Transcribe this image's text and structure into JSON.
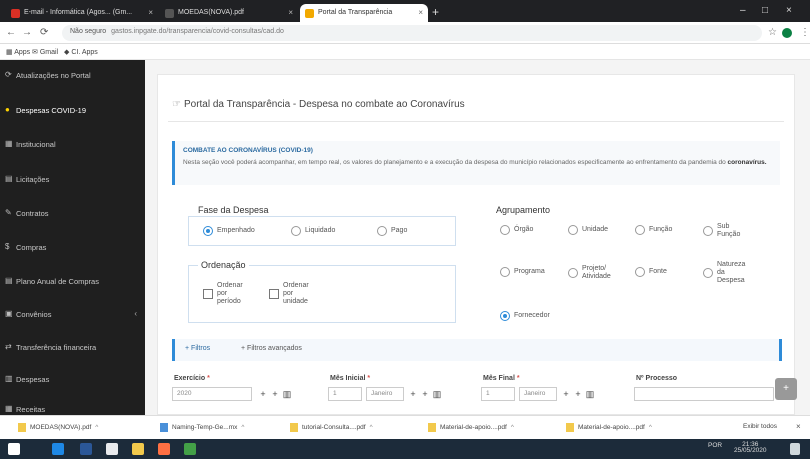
{
  "browser": {
    "tabs": [
      {
        "title": "E-mail - Informática (Agos... (Gm..."
      },
      {
        "title": "MOEDAS(NOVA).pdf"
      },
      {
        "title": "Portal da Transparência"
      }
    ],
    "address": {
      "scheme": "Não seguro",
      "url": "gastos.inpgate.do/transparencia/covid-consultas/cad.do"
    },
    "bookmarks": [
      {
        "label": "Apps"
      },
      {
        "label": "Gmail"
      },
      {
        "label": "CI. Apps"
      }
    ],
    "window_controls": {
      "minimize": "–",
      "maximize": "□",
      "close": "×"
    }
  },
  "sidebar": {
    "items": [
      {
        "label": "Atualizações no Portal",
        "icon": "refresh-icon",
        "glyph": "⟳"
      },
      {
        "label": "Despesas COVID-19",
        "icon": "dot-icon",
        "glyph": "●"
      },
      {
        "label": "Institucional",
        "icon": "building-icon",
        "glyph": "▦"
      },
      {
        "label": "Licitações",
        "icon": "gavel-icon",
        "glyph": "▤"
      },
      {
        "label": "Contratos",
        "icon": "handshake-icon",
        "glyph": "✎"
      },
      {
        "label": "Compras",
        "icon": "dollar-icon",
        "glyph": "$"
      },
      {
        "label": "Plano Anual de Compras",
        "icon": "list-icon",
        "glyph": "▤"
      },
      {
        "label": "Convênios",
        "icon": "people-icon",
        "glyph": "▣",
        "chevron": "‹"
      },
      {
        "label": "Transferência financeira",
        "icon": "transfer-icon",
        "glyph": "⇄"
      },
      {
        "label": "Despesas",
        "icon": "cart-icon",
        "glyph": "▥"
      },
      {
        "label": "Receitas",
        "icon": "chart-icon",
        "glyph": "▦"
      }
    ]
  },
  "page": {
    "title": "Portal da Transparência - Despesa no combate ao Coronavírus",
    "notice": {
      "title": "COMBATE AO CORONAVÍRUS (COVID-19)",
      "text": "Nesta seção você poderá acompanhar, em tempo real, os valores do planejamento e a execução da despesa do município relacionados especificamente ao enfrentamento da pandemia do",
      "highlight": "coronavírus."
    },
    "fase": {
      "title": "Fase da Despesa",
      "options": [
        {
          "label": "Empenhado",
          "selected": true
        },
        {
          "label": "Liquidado",
          "selected": false
        },
        {
          "label": "Pago",
          "selected": false
        }
      ]
    },
    "ordenacao": {
      "title": "Ordenação",
      "options": [
        {
          "label": "Ordenar\npor\nperíodo"
        },
        {
          "label": "Ordenar\npor\nunidade"
        }
      ]
    },
    "agrupamento": {
      "title": "Agrupamento",
      "options": [
        {
          "label": "Órgão",
          "selected": false
        },
        {
          "label": "Unidade",
          "selected": false
        },
        {
          "label": "Função",
          "selected": false
        },
        {
          "label": "Sub\nFunção",
          "selected": false
        },
        {
          "label": "Programa",
          "selected": false
        },
        {
          "label": "Projeto/\nAtividade",
          "selected": false
        },
        {
          "label": "Fonte",
          "selected": false
        },
        {
          "label": "Natureza\nda\nDespesa",
          "selected": false
        },
        {
          "label": "Fornecedor",
          "selected": true
        }
      ]
    },
    "filter_tabs": [
      {
        "label": "Filtros",
        "icon": "plus-icon"
      },
      {
        "label": "Filtros avançados",
        "icon": "plus-icon"
      }
    ],
    "fields": [
      {
        "label": "Exercício",
        "required": "*",
        "value": "2020"
      },
      {
        "label": "Mês Inicial",
        "required": "*",
        "value": "1",
        "month": "Janeiro"
      },
      {
        "label": "Mês Final",
        "required": "*",
        "value": "1",
        "month": "Janeiro"
      },
      {
        "label": "Nº Processo",
        "required": "",
        "value": ""
      }
    ]
  },
  "downloads": {
    "items": [
      {
        "label": "MOEDAS(NOVA).pdf"
      },
      {
        "label": "Naming-Temp-Ge...mx"
      },
      {
        "label": "tutorial-Consulta....pdf"
      },
      {
        "label": "Material-de-apoio....pdf"
      },
      {
        "label": "Material-de-apoio....pdf"
      }
    ],
    "show_all": "Exibir todos"
  },
  "taskbar": {
    "time": "21:36",
    "date": "25/05/2020",
    "lang": "POR"
  }
}
